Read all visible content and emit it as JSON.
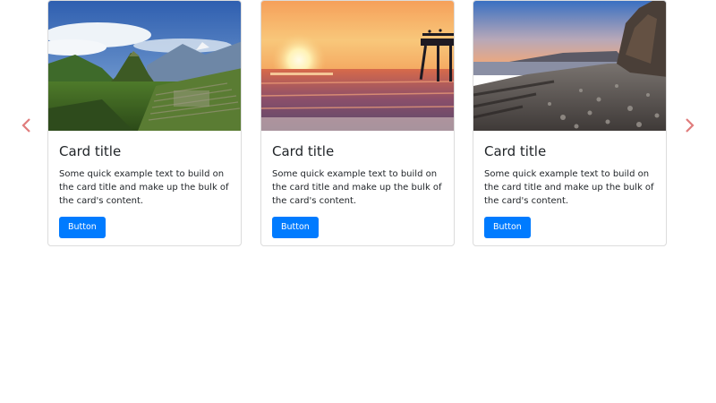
{
  "carousel": {
    "prev_icon": "chevron-left-icon",
    "next_icon": "chevron-right-icon",
    "arrow_color": "#e07c7c",
    "accent_color": "#007bff"
  },
  "cards": [
    {
      "image": "mountain-ruins-photo",
      "title": "Card title",
      "text": "Some quick example text to build on the card title and make up the bulk of the card's content.",
      "button_label": "Button"
    },
    {
      "image": "sunset-pier-photo",
      "title": "Card title",
      "text": "Some quick example text to build on the card title and make up the bulk of the card's content.",
      "button_label": "Button"
    },
    {
      "image": "rocky-beach-cliff-photo",
      "title": "Card title",
      "text": "Some quick example text to build on the card title and make up the bulk of the card's content.",
      "button_label": "Button"
    }
  ]
}
